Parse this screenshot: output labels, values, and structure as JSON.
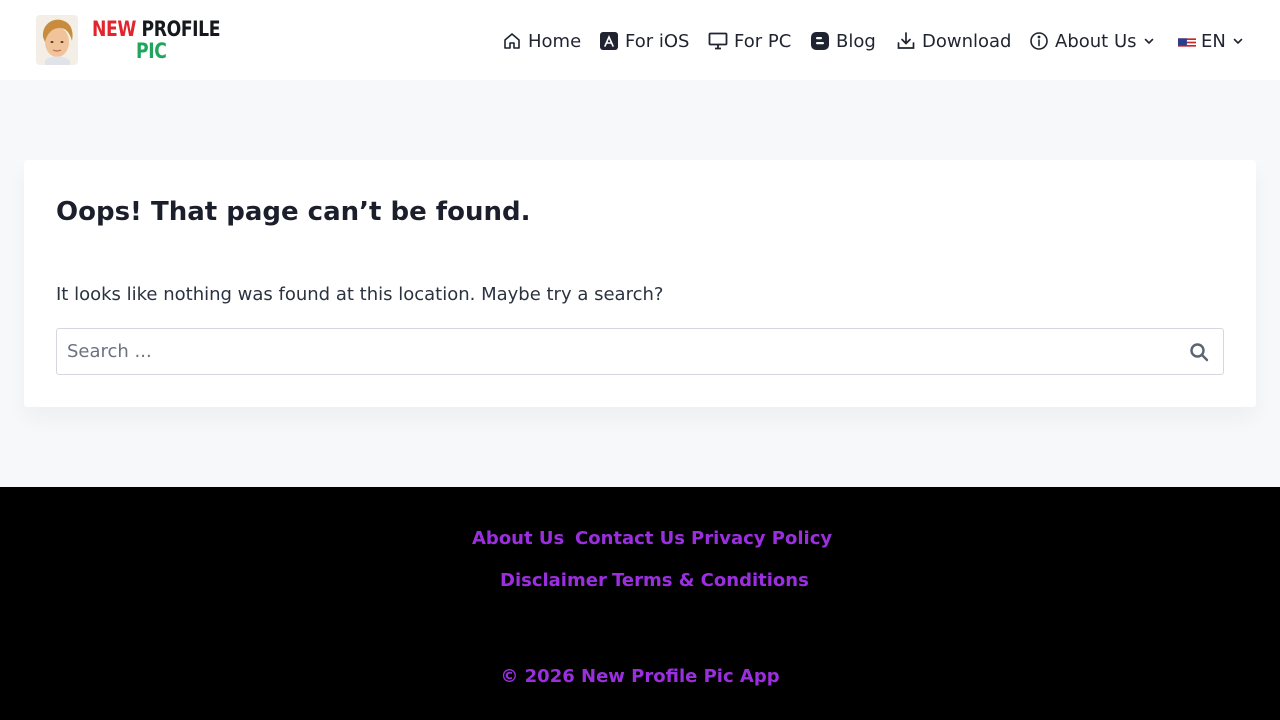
{
  "header": {
    "logo": {
      "line1_word1": "NEW",
      "line1_word2": "PROFILE",
      "line2": "PIC"
    },
    "nav": [
      {
        "label": "Home",
        "icon": "home-icon"
      },
      {
        "label": "For iOS",
        "icon": "app-store-icon"
      },
      {
        "label": "For PC",
        "icon": "monitor-icon"
      },
      {
        "label": "Blog",
        "icon": "blogger-icon"
      },
      {
        "label": "Download",
        "icon": "download-icon"
      },
      {
        "label": "About Us",
        "icon": "info-icon",
        "dropdown": true
      }
    ],
    "language": {
      "label": "EN",
      "icon": "us-flag-icon"
    }
  },
  "main": {
    "title": "Oops! That page can’t be found.",
    "description": "It looks like nothing was found at this location. Maybe try a search?",
    "search": {
      "placeholder": "Search ...",
      "value": ""
    }
  },
  "footer": {
    "links_row1": [
      "About Us",
      "Contact Us",
      "Privacy Policy"
    ],
    "links_row2": [
      "Disclaimer",
      "Terms & Conditions"
    ],
    "copyright": "© 2026 New Profile Pic App"
  },
  "colors": {
    "footer_bg": "#000000",
    "footer_link": "#9b2fe0",
    "page_bg": "#f7f8fa",
    "logo_red": "#e2252c",
    "logo_green": "#1fa65c"
  }
}
